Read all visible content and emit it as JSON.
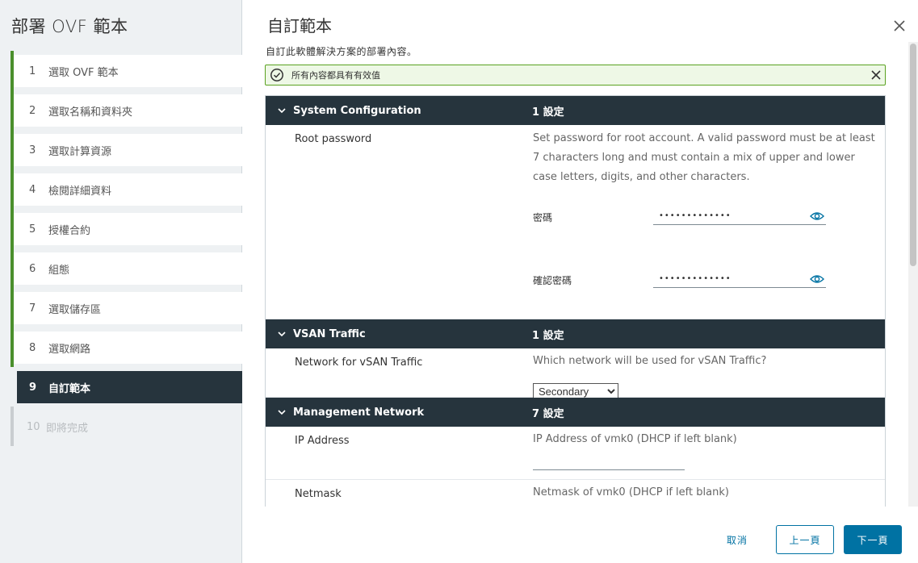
{
  "wizard": {
    "title": "部署 OVF 範本",
    "steps": [
      {
        "num": "1",
        "label": "選取 OVF 範本"
      },
      {
        "num": "2",
        "label": "選取名稱和資料夾"
      },
      {
        "num": "3",
        "label": "選取計算資源"
      },
      {
        "num": "4",
        "label": "檢閱詳細資料"
      },
      {
        "num": "5",
        "label": "授權合約"
      },
      {
        "num": "6",
        "label": "組態"
      },
      {
        "num": "7",
        "label": "選取儲存區"
      },
      {
        "num": "8",
        "label": "選取網路"
      },
      {
        "num": "9",
        "label": "自訂範本"
      },
      {
        "num": "10",
        "label": "即將完成"
      }
    ]
  },
  "page": {
    "title": "自訂範本",
    "subtitle": "自訂此軟體解決方案的部署內容。",
    "alert_text": "所有內容都具有有效值"
  },
  "sections": {
    "system": {
      "name": "System Configuration",
      "count": "1 設定",
      "root_label": "Root password",
      "root_desc": "Set password for root account. A valid password must be at least 7 characters long and must contain a mix of upper and lower case letters, digits, and other characters.",
      "password_label": "密碼",
      "password_value": "•••••••••••••",
      "confirm_label": "確認密碼",
      "confirm_value": "•••••••••••••"
    },
    "vsan": {
      "name": "VSAN Traffic",
      "count": "1 設定",
      "net_label": "Network for vSAN Traffic",
      "net_desc": "Which network will be used for vSAN Traffic?",
      "net_selected": "Secondary"
    },
    "mgmt": {
      "name": "Management Network",
      "count": "7 設定",
      "ip_label": "IP Address",
      "ip_desc": "IP Address of vmk0 (DHCP if left blank)",
      "netmask_label": "Netmask",
      "netmask_desc": "Netmask of vmk0 (DHCP if left blank)"
    }
  },
  "footer": {
    "cancel": "取消",
    "back": "上一頁",
    "next": "下一頁"
  },
  "colors": {
    "header_bg": "#26343d",
    "accent": "#0072a3",
    "success": "#5aa220"
  }
}
